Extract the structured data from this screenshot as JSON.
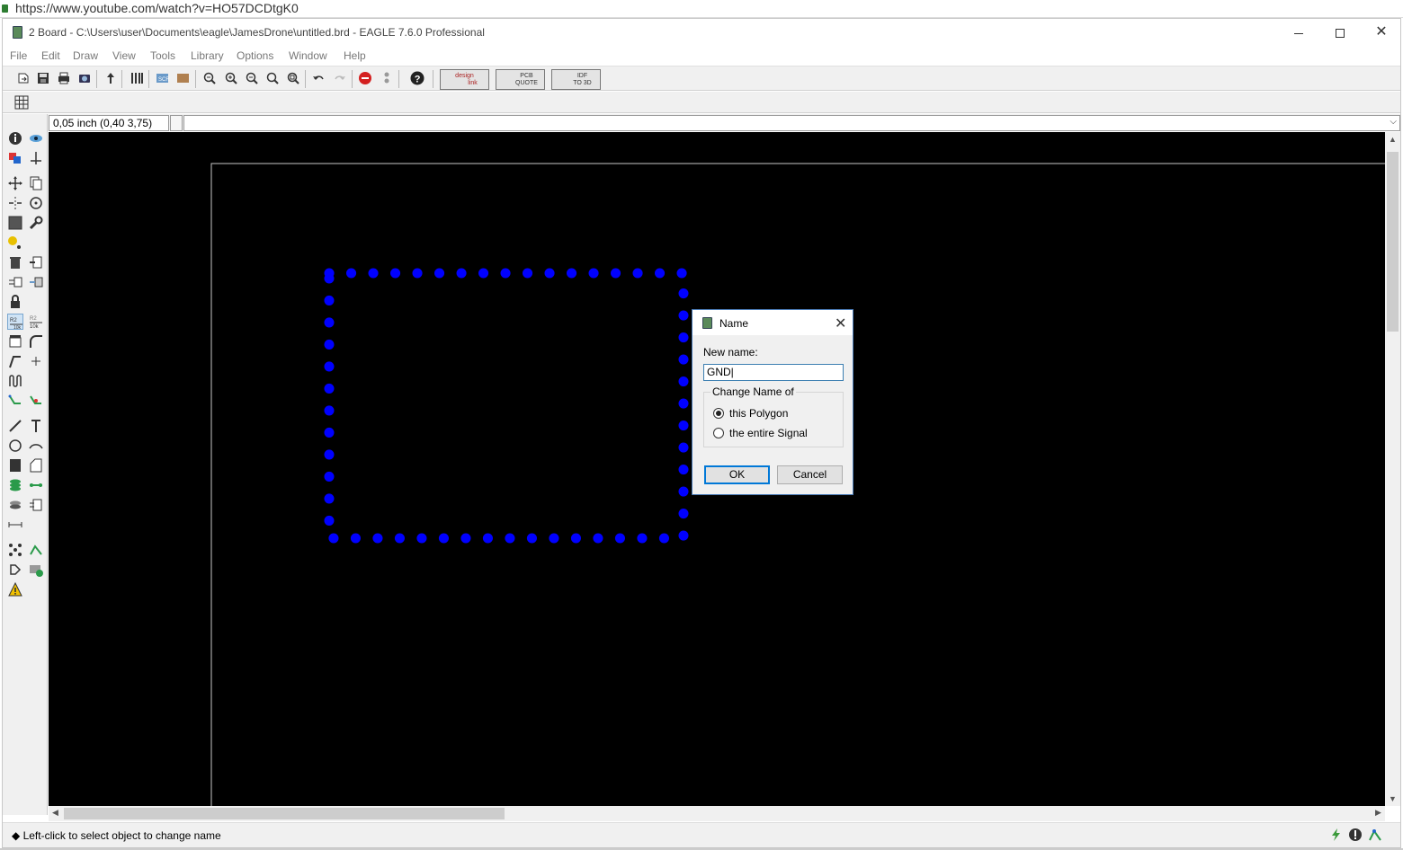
{
  "browser": {
    "url": "https://www.youtube.com/watch?v=HO57DCDtgK0"
  },
  "window": {
    "title": "2 Board - C:\\Users\\user\\Documents\\eagle\\JamesDrone\\untitled.brd - EAGLE 7.6.0 Professional",
    "minimize_label": "minimize",
    "maximize_label": "maximize",
    "close_label": "close"
  },
  "menu": [
    "File",
    "Edit",
    "Draw",
    "View",
    "Tools",
    "Library",
    "Options",
    "Window",
    "Help"
  ],
  "toolbar": {
    "designlink_label_1": "design",
    "designlink_label_2": "link",
    "pcbquote_label_1": "PCB",
    "pcbquote_label_2": "QUOTE",
    "idf_label_1": "IDF",
    "idf_label_2": "TO 3D"
  },
  "coords": {
    "value": "0,05 inch (0,40 3,75)"
  },
  "dialog": {
    "title": "Name",
    "new_name_label": "New name:",
    "new_name_value": "GND|",
    "group_label": "Change Name of",
    "option_polygon": "this Polygon",
    "option_signal": "the entire Signal",
    "selected": "this Polygon",
    "ok_label": "OK",
    "cancel_label": "Cancel"
  },
  "status": {
    "message": "Left-click to select object to change name"
  },
  "colors": {
    "canvas_bg": "#000000",
    "polygon": "#0000ff",
    "frame": "#c8c8c8",
    "accent": "#0078d7"
  }
}
